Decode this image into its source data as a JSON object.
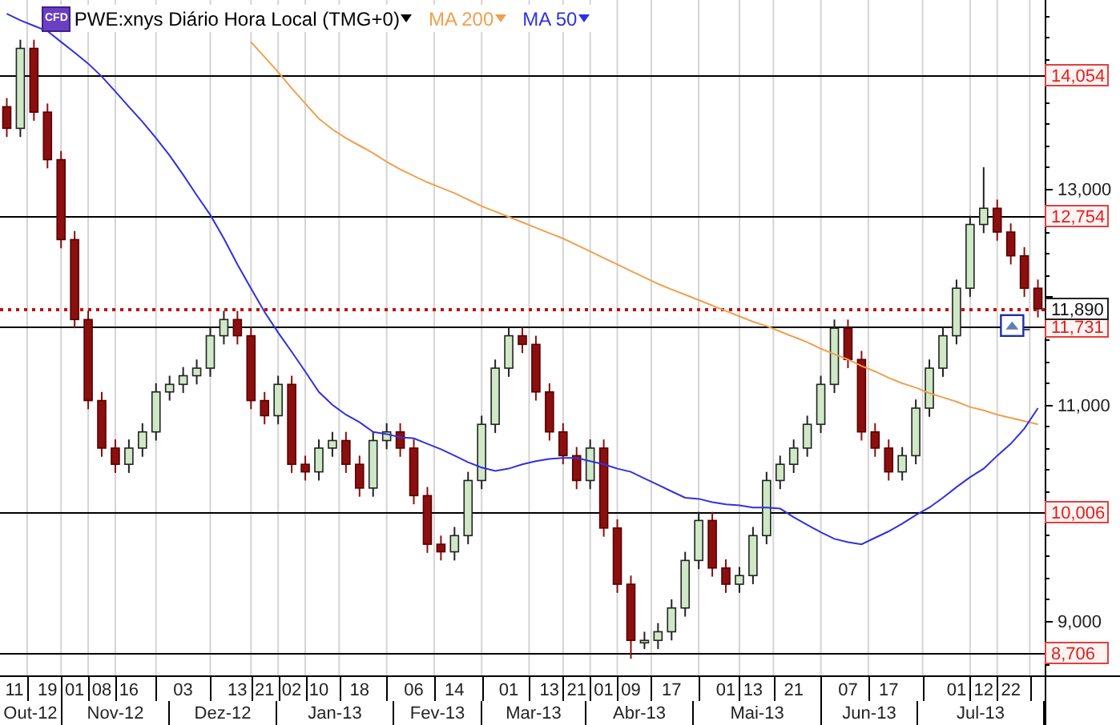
{
  "header": {
    "badge": "CFD",
    "title": "PWE:xnys Diário Hora Local (TMG+0)"
  },
  "chart_data": {
    "type": "candlestick",
    "categories": [
      "11",
      null,
      null,
      "19",
      null,
      "01",
      null,
      "08",
      null,
      "16",
      null,
      null,
      null,
      "03",
      null,
      null,
      null,
      "13",
      null,
      "21",
      null,
      "02",
      null,
      "10",
      null,
      null,
      "18",
      null,
      null,
      null,
      "06",
      null,
      null,
      "14",
      null,
      null,
      null,
      "01",
      null,
      null,
      "13",
      null,
      "21",
      null,
      "01",
      null,
      "09",
      null,
      null,
      "17",
      null,
      null,
      null,
      "01",
      null,
      "13",
      null,
      null,
      "21",
      null,
      null,
      null,
      "07",
      null,
      null,
      "17",
      null,
      null,
      null,
      null,
      "01",
      null,
      "12",
      null,
      "22",
      null,
      null
    ],
    "ohlc": [
      [
        13760,
        13840,
        13480,
        13560
      ],
      [
        13560,
        14380,
        13480,
        14300
      ],
      [
        14300,
        14380,
        13630,
        13710
      ],
      [
        13710,
        13790,
        13190,
        13270
      ],
      [
        13270,
        13350,
        12450,
        12530
      ],
      [
        12530,
        12610,
        11710,
        11790
      ],
      [
        11790,
        11870,
        10960,
        11040
      ],
      [
        11040,
        11120,
        10520,
        10600
      ],
      [
        10600,
        10680,
        10370,
        10450
      ],
      [
        10450,
        10680,
        10370,
        10600
      ],
      [
        10600,
        10830,
        10520,
        10750
      ],
      [
        10750,
        11200,
        10670,
        11120
      ],
      [
        11120,
        11270,
        11040,
        11190
      ],
      [
        11190,
        11350,
        11110,
        11270
      ],
      [
        11270,
        11420,
        11190,
        11340
      ],
      [
        11340,
        11720,
        11260,
        11640
      ],
      [
        11640,
        11870,
        11560,
        11790
      ],
      [
        11790,
        11870,
        11560,
        11640
      ],
      [
        11640,
        11720,
        10960,
        11040
      ],
      [
        11040,
        11120,
        10820,
        10900
      ],
      [
        10900,
        11270,
        10820,
        11190
      ],
      [
        11190,
        11270,
        10370,
        10450
      ],
      [
        10450,
        10530,
        10300,
        10380
      ],
      [
        10380,
        10680,
        10300,
        10600
      ],
      [
        10600,
        10750,
        10520,
        10670
      ],
      [
        10670,
        10750,
        10370,
        10450
      ],
      [
        10450,
        10530,
        10150,
        10230
      ],
      [
        10230,
        10750,
        10150,
        10670
      ],
      [
        10670,
        10830,
        10590,
        10750
      ],
      [
        10750,
        10830,
        10520,
        10600
      ],
      [
        10600,
        10680,
        10080,
        10160
      ],
      [
        10160,
        10240,
        9630,
        9710
      ],
      [
        9710,
        9790,
        9560,
        9640
      ],
      [
        9640,
        9870,
        9560,
        9790
      ],
      [
        9790,
        10380,
        9710,
        10300
      ],
      [
        10300,
        10900,
        10220,
        10820
      ],
      [
        10820,
        11420,
        10740,
        11340
      ],
      [
        11340,
        11720,
        11260,
        11640
      ],
      [
        11640,
        11720,
        11480,
        11560
      ],
      [
        11560,
        11640,
        11040,
        11120
      ],
      [
        11120,
        11200,
        10670,
        10750
      ],
      [
        10750,
        10830,
        10450,
        10530
      ],
      [
        10530,
        10610,
        10220,
        10300
      ],
      [
        10300,
        10680,
        10220,
        10600
      ],
      [
        10600,
        10680,
        9780,
        9860
      ],
      [
        9860,
        9940,
        9260,
        9340
      ],
      [
        9340,
        9420,
        8650,
        8820
      ],
      [
        8820,
        8900,
        8740,
        8820
      ],
      [
        8820,
        8980,
        8740,
        8900
      ],
      [
        8900,
        9200,
        8820,
        9120
      ],
      [
        9120,
        9640,
        9040,
        9560
      ],
      [
        9560,
        10010,
        9480,
        9930
      ],
      [
        9930,
        10010,
        9410,
        9490
      ],
      [
        9490,
        9570,
        9260,
        9340
      ],
      [
        9340,
        9500,
        9260,
        9420
      ],
      [
        9420,
        9870,
        9340,
        9790
      ],
      [
        9790,
        10380,
        9710,
        10300
      ],
      [
        10300,
        10530,
        10220,
        10450
      ],
      [
        10450,
        10680,
        10370,
        10600
      ],
      [
        10600,
        10900,
        10520,
        10820
      ],
      [
        10820,
        11270,
        10740,
        11190
      ],
      [
        11190,
        11790,
        11110,
        11710
      ],
      [
        11710,
        11790,
        11340,
        11420
      ],
      [
        11420,
        11500,
        10670,
        10750
      ],
      [
        10750,
        10830,
        10520,
        10600
      ],
      [
        10600,
        10680,
        10300,
        10380
      ],
      [
        10380,
        10610,
        10300,
        10530
      ],
      [
        10530,
        11050,
        10450,
        10970
      ],
      [
        10970,
        11420,
        10890,
        11340
      ],
      [
        11340,
        11720,
        11260,
        11640
      ],
      [
        11640,
        12160,
        11560,
        12080
      ],
      [
        12080,
        12750,
        12000,
        12670
      ],
      [
        12670,
        13200,
        12590,
        12820
      ],
      [
        12820,
        12900,
        12520,
        12600
      ],
      [
        12600,
        12680,
        12300,
        12380
      ],
      [
        12380,
        12460,
        12000,
        12080
      ],
      [
        12080,
        12160,
        11810,
        11890
      ]
    ],
    "series": [
      {
        "name": "MA 200",
        "type": "line",
        "color": "#f0a050",
        "values": [
          null,
          null,
          null,
          null,
          null,
          null,
          null,
          null,
          null,
          null,
          null,
          null,
          null,
          null,
          null,
          null,
          null,
          null,
          14360,
          14220,
          14080,
          13930,
          13790,
          13650,
          13550,
          13470,
          13400,
          13330,
          13250,
          13180,
          13120,
          13060,
          13010,
          12960,
          12900,
          12840,
          12790,
          12740,
          12690,
          12640,
          12590,
          12540,
          12480,
          12420,
          12360,
          12300,
          12240,
          12180,
          12120,
          12070,
          12020,
          11970,
          11920,
          11870,
          11820,
          11770,
          11730,
          11680,
          11630,
          11580,
          11520,
          11470,
          11420,
          11360,
          11310,
          11250,
          11200,
          11160,
          11110,
          11070,
          11030,
          10980,
          10950,
          10910,
          10880,
          10850,
          10820
        ]
      },
      {
        "name": "MA 50",
        "type": "line",
        "color": "#3030e0",
        "values": [
          14620,
          14560,
          14510,
          14460,
          14360,
          14260,
          14160,
          14040,
          13900,
          13760,
          13620,
          13470,
          13310,
          13130,
          12940,
          12760,
          12540,
          12300,
          12080,
          11860,
          11670,
          11490,
          11310,
          11120,
          11000,
          10910,
          10840,
          10750,
          10730,
          10700,
          10690,
          10640,
          10590,
          10530,
          10470,
          10420,
          10390,
          10410,
          10450,
          10480,
          10500,
          10510,
          10510,
          10480,
          10450,
          10410,
          10380,
          10320,
          10260,
          10200,
          10140,
          10130,
          10100,
          10080,
          10070,
          10050,
          10050,
          10040,
          9960,
          9890,
          9820,
          9760,
          9730,
          9710,
          9770,
          9830,
          9900,
          9980,
          10050,
          10140,
          10240,
          10330,
          10410,
          10530,
          10640,
          10780,
          10970
        ]
      }
    ],
    "ylim": [
      8496,
      14748
    ],
    "yticks": [
      {
        "value": 13000,
        "label": "13,000"
      },
      {
        "value": 11000,
        "label": "11,000"
      },
      {
        "value": 9000,
        "label": "9,000"
      }
    ],
    "ref_lines": [
      {
        "axis": "y",
        "value": 14054,
        "label": "14,054",
        "color": "#000000"
      },
      {
        "axis": "y",
        "value": 12754,
        "label": "12,754",
        "color": "#000000"
      },
      {
        "axis": "y",
        "value": 11731,
        "label": "11,731",
        "color": "#000000"
      },
      {
        "axis": "y",
        "value": 10006,
        "label": "10,006",
        "color": "#000000"
      },
      {
        "axis": "y",
        "value": 8706,
        "label": "8,706",
        "color": "#000000"
      },
      {
        "axis": "y",
        "value": 11890,
        "label": "11,890",
        "color": "#c01010"
      }
    ]
  },
  "months": [
    "Out-12",
    "Nov-12",
    "Dez-12",
    "Jan-13",
    "Fev-13",
    "Mar-13",
    "Abr-13",
    "Mai-13",
    "Jun-13",
    "Jul-13"
  ]
}
